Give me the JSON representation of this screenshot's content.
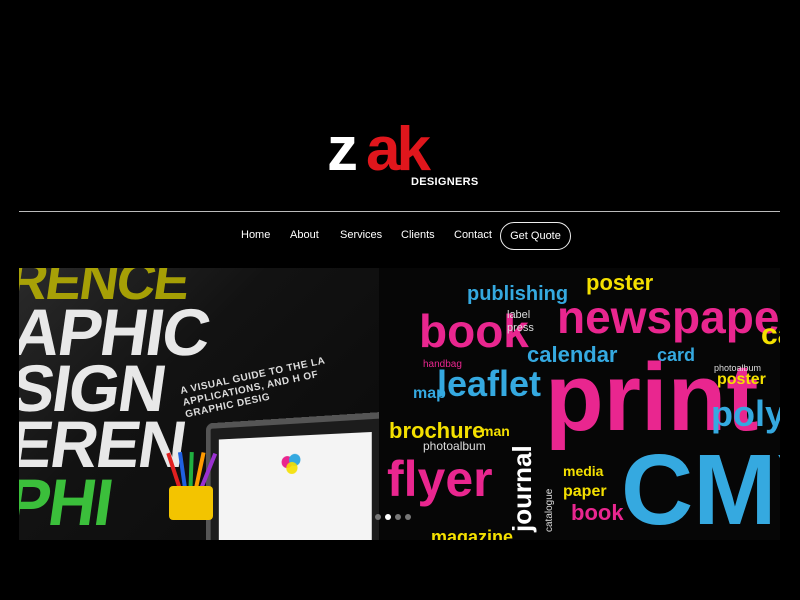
{
  "logo": {
    "z": "z",
    "ak": "ak",
    "sub": "DESIGNERS",
    "colors": {
      "z": "#ffffff",
      "ak": "#e0161c"
    }
  },
  "nav": {
    "items": [
      {
        "label": "Home"
      },
      {
        "label": "About"
      },
      {
        "label": "Services"
      },
      {
        "label": "Clients"
      },
      {
        "label": "Contact"
      }
    ],
    "quote_label": "Get Quote"
  },
  "hero": {
    "left_words": [
      "APHIC",
      "SIGN",
      "EREN",
      "PHI",
      "RENCE"
    ],
    "left_caption": "A VISUAL GUIDE TO THE LA APPLICATIONS, AND H OF GRAPHIC DESIG",
    "cloud": {
      "publishing": "publishing",
      "poster": "poster",
      "newspaper": "newspaper",
      "book": "book",
      "label": "label",
      "press": "press",
      "calendar": "calendar",
      "card": "card",
      "car": "car",
      "leaflet": "leaflet",
      "map": "map",
      "handbag": "handbag",
      "print": "print",
      "photoalbum": "photoalbum",
      "poster2": "poster",
      "polygr": "polygr",
      "brochure": "brochure",
      "man": "man",
      "journal": "journal",
      "flyer": "flyer",
      "photoalbum2": "photoalbum",
      "media": "media",
      "paper": "paper",
      "catalogue": "catalogue",
      "book2": "book",
      "cmy": "CMY",
      "magazine": "magazine"
    },
    "colors": {
      "pink": "#e9268f",
      "blue": "#35a9e0",
      "yellow": "#f4e000",
      "white": "#ffffff"
    }
  },
  "slider": {
    "count": 4,
    "active": 1
  }
}
